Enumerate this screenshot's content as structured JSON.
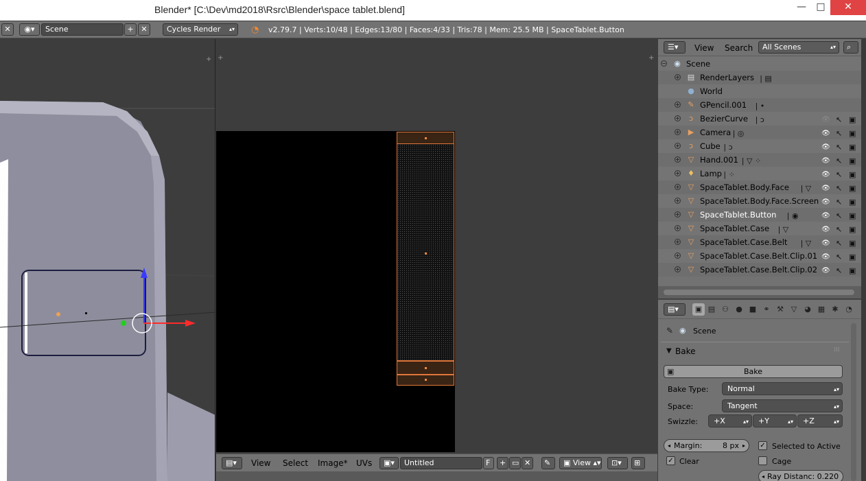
{
  "window": {
    "title": "Blender* [C:\\Dev\\md2018\\Rsrc\\Blender\\space tablet.blend]",
    "min_symbol": "—",
    "max_symbol": "□",
    "close_symbol": "✕"
  },
  "infobar": {
    "scene_name": "Scene",
    "render_engine": "Cycles Render",
    "stats": "v2.79.7 | Verts:10/48 | Edges:13/80 | Faces:4/33 | Tris:78 | Mem: 25.5 MB | SpaceTablet.Button"
  },
  "uv_editor": {
    "menu_view": "View",
    "menu_select": "Select",
    "menu_image": "Image*",
    "menu_uvs": "UVs",
    "image_name": "Untitled",
    "fake_user": "F",
    "view_selector": "View"
  },
  "outliner": {
    "menu_view": "View",
    "menu_search": "Search",
    "display_mode": "All Scenes",
    "items": [
      {
        "label": "Scene",
        "icon": "scene-icon",
        "glyph": "◉",
        "color": "#cfe0f0",
        "indent": 0,
        "expand": "−",
        "vis": false,
        "extra": ""
      },
      {
        "label": "RenderLayers",
        "icon": "renderlayers-icon",
        "glyph": "▤",
        "color": "#d8d8d8",
        "indent": 1,
        "expand": "+",
        "vis": false,
        "extra": "▤"
      },
      {
        "label": "World",
        "icon": "world-icon",
        "glyph": "●",
        "color": "#8fb0d0",
        "indent": 1,
        "expand": "",
        "vis": false,
        "extra": ""
      },
      {
        "label": "GPencil.001",
        "icon": "gpencil-icon",
        "glyph": "✎",
        "color": "#e8a060",
        "indent": 1,
        "expand": "+",
        "vis": false,
        "extra": "•"
      },
      {
        "label": "BezierCurve",
        "icon": "curve-icon",
        "glyph": "ↄ",
        "color": "#e8a060",
        "indent": 1,
        "expand": "+",
        "vis": true,
        "dim": true,
        "extra": "ↄ"
      },
      {
        "label": "Camera",
        "icon": "camera-icon",
        "glyph": "▶",
        "color": "#e8a060",
        "indent": 1,
        "expand": "+",
        "vis": true,
        "extra": "◎"
      },
      {
        "label": "Cube",
        "icon": "curve-icon",
        "glyph": "ↄ",
        "color": "#e8a060",
        "indent": 1,
        "expand": "+",
        "vis": true,
        "extra": "ↄ"
      },
      {
        "label": "Hand.001",
        "icon": "mesh-icon",
        "glyph": "▽",
        "color": "#e8a060",
        "indent": 1,
        "expand": "+",
        "vis": true,
        "extra": "▽ ⁘"
      },
      {
        "label": "Lamp",
        "icon": "lamp-icon",
        "glyph": "♦",
        "color": "#f0c060",
        "indent": 1,
        "expand": "+",
        "vis": true,
        "extra": "⁘"
      },
      {
        "label": "SpaceTablet.Body.Face",
        "icon": "mesh-icon",
        "glyph": "▽",
        "color": "#e8a060",
        "indent": 1,
        "expand": "+",
        "vis": true,
        "extra": "▽"
      },
      {
        "label": "SpaceTablet.Body.Face.Screen",
        "icon": "mesh-icon",
        "glyph": "▽",
        "color": "#e8a060",
        "indent": 1,
        "expand": "+",
        "vis": true,
        "extra": ""
      },
      {
        "label": "SpaceTablet.Button",
        "icon": "mesh-icon",
        "glyph": "▽",
        "color": "#e8a060",
        "indent": 1,
        "expand": "+",
        "vis": true,
        "selected": true,
        "extra": "◉"
      },
      {
        "label": "SpaceTablet.Case",
        "icon": "mesh-icon",
        "glyph": "▽",
        "color": "#e8a060",
        "indent": 1,
        "expand": "+",
        "vis": true,
        "extra": "▽"
      },
      {
        "label": "SpaceTablet.Case.Belt",
        "icon": "mesh-icon",
        "glyph": "▽",
        "color": "#e8a060",
        "indent": 1,
        "expand": "+",
        "vis": true,
        "extra": "▽"
      },
      {
        "label": "SpaceTablet.Case.Belt.Clip.01",
        "icon": "mesh-icon",
        "glyph": "▽",
        "color": "#e8a060",
        "indent": 1,
        "expand": "+",
        "vis": true,
        "extra": ""
      },
      {
        "label": "SpaceTablet.Case.Belt.Clip.02",
        "icon": "mesh-icon",
        "glyph": "▽",
        "color": "#e8a060",
        "indent": 1,
        "expand": "+",
        "vis": true,
        "extra": ""
      }
    ]
  },
  "properties": {
    "context": "Scene",
    "panel_title": "Bake",
    "bake_button": "Bake",
    "bake_type_label": "Bake Type:",
    "bake_type_value": "Normal",
    "space_label": "Space:",
    "space_value": "Tangent",
    "swizzle_label": "Swizzle:",
    "swizzle_x": "+X",
    "swizzle_y": "+Y",
    "swizzle_z": "+Z",
    "margin_label": "Margin:",
    "margin_value": "8 px",
    "selected_to_active_label": "Selected to Active",
    "selected_to_active_checked": true,
    "clear_label": "Clear",
    "clear_checked": true,
    "cage_label": "Cage",
    "cage_checked": false,
    "ray_distance": "Ray Distanc: 0.220"
  },
  "colors": {
    "uv_selection": "#e0773a",
    "selected_text": "#ffffff",
    "close_button": "#e04343"
  }
}
